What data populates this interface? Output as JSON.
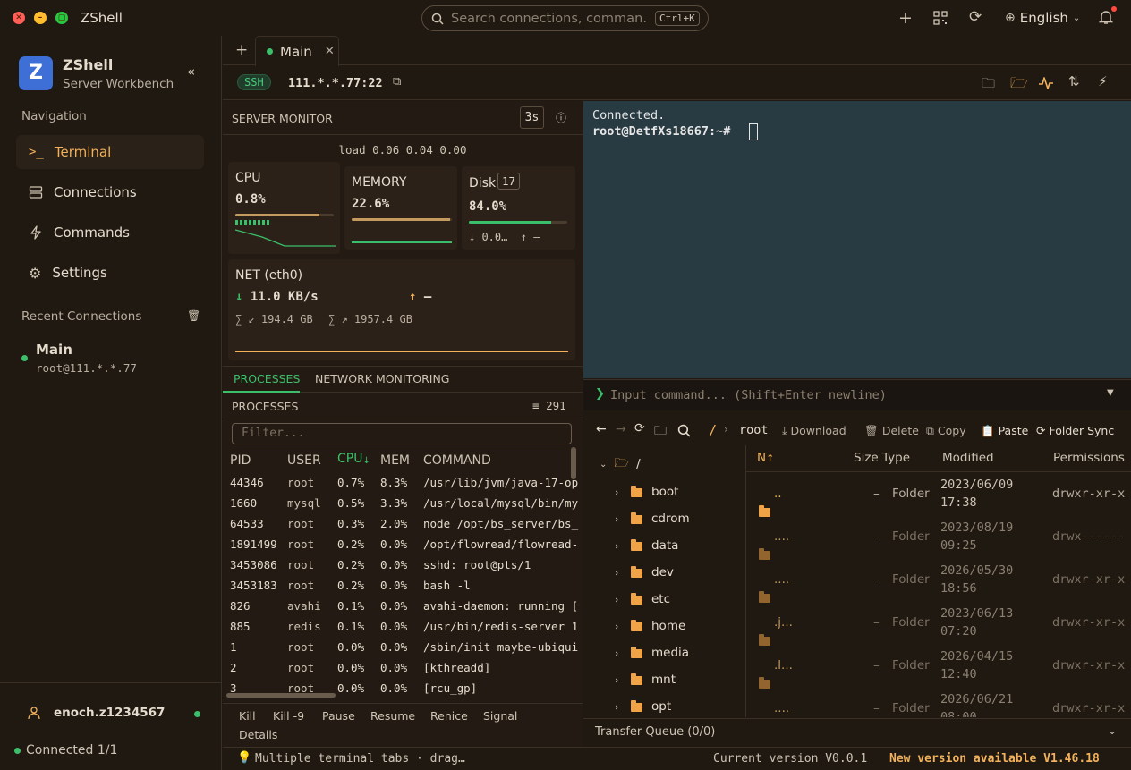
{
  "app": {
    "title": "ZShell",
    "subtitle": "Server Workbench"
  },
  "search": {
    "placeholder": "Search connections, comman…",
    "shortcut": "Ctrl+K"
  },
  "topbar": {
    "language": "English"
  },
  "sidebar": {
    "nav_heading": "Navigation",
    "items": [
      {
        "label": "Terminal"
      },
      {
        "label": "Connections"
      },
      {
        "label": "Commands"
      },
      {
        "label": "Settings"
      }
    ],
    "recent_heading": "Recent Connections",
    "recent": [
      {
        "name": "Main",
        "addr": "root@111.*.*.77"
      }
    ],
    "user": "enoch.z1234567",
    "connected": "Connected 1/1"
  },
  "tabs": [
    {
      "label": "Main"
    }
  ],
  "host": {
    "protocol": "SSH",
    "address": "111.*.*.77:22"
  },
  "monitor": {
    "title": "SERVER MONITOR",
    "interval": "3s",
    "load": "load 0.06 0.04 0.00",
    "cpu": {
      "label": "CPU",
      "value": "0.8%",
      "fraction": 0.008
    },
    "memory": {
      "label": "MEMORY",
      "value": "22.6%",
      "fraction": 0.226
    },
    "disk": {
      "label": "Disk",
      "count": "17",
      "value": "84.0%",
      "fraction": 0.84,
      "read": "0.0…",
      "write": "–"
    },
    "net": {
      "label": "NET (eth0)",
      "down": "11.0 KB/s",
      "up": "–",
      "total_down": "194.4 GB",
      "total_up": "1957.4 GB"
    }
  },
  "proc_tabs": [
    {
      "label": "PROCESSES"
    },
    {
      "label": "NETWORK MONITORING"
    }
  ],
  "processes": {
    "title": "PROCESSES",
    "count": "291",
    "filter_placeholder": "Filter...",
    "columns": [
      "PID",
      "USER",
      "CPU",
      "MEM",
      "COMMAND"
    ],
    "rows": [
      {
        "pid": "44346",
        "user": "root",
        "cpu": "0.7%",
        "mem": "8.3%",
        "cmd": "/usr/lib/jvm/java-17-op"
      },
      {
        "pid": "1660",
        "user": "mysql",
        "cpu": "0.5%",
        "mem": "3.3%",
        "cmd": "/usr/local/mysql/bin/my"
      },
      {
        "pid": "64533",
        "user": "root",
        "cpu": "0.3%",
        "mem": "2.0%",
        "cmd": "node /opt/bs_server/bs_"
      },
      {
        "pid": "1891499",
        "user": "root",
        "cpu": "0.2%",
        "mem": "0.0%",
        "cmd": "/opt/flowread/flowread-"
      },
      {
        "pid": "3453086",
        "user": "root",
        "cpu": "0.2%",
        "mem": "0.0%",
        "cmd": "sshd: root@pts/1"
      },
      {
        "pid": "3453183",
        "user": "root",
        "cpu": "0.2%",
        "mem": "0.0%",
        "cmd": "bash -l"
      },
      {
        "pid": "826",
        "user": "avahi",
        "cpu": "0.1%",
        "mem": "0.0%",
        "cmd": "avahi-daemon: running ["
      },
      {
        "pid": "885",
        "user": "redis",
        "cpu": "0.1%",
        "mem": "0.0%",
        "cmd": "/usr/bin/redis-server 1"
      },
      {
        "pid": "1",
        "user": "root",
        "cpu": "0.0%",
        "mem": "0.0%",
        "cmd": "/sbin/init maybe-ubiqui"
      },
      {
        "pid": "2",
        "user": "root",
        "cpu": "0.0%",
        "mem": "0.0%",
        "cmd": "[kthreadd]"
      },
      {
        "pid": "3",
        "user": "root",
        "cpu": "0.0%",
        "mem": "0.0%",
        "cmd": "[rcu_gp]"
      }
    ],
    "actions": [
      "Kill",
      "Kill -9",
      "Pause",
      "Resume",
      "Renice",
      "Signal",
      "Details"
    ]
  },
  "terminal": {
    "line1": "Connected.",
    "prompt": "root@DetfXs18667:~#"
  },
  "cmdline": {
    "placeholder": "Input command... (Shift+Enter newline)"
  },
  "files": {
    "breadcrumb_root": "/",
    "breadcrumb_dir": "root",
    "toolbar": [
      "Download",
      "Delete",
      "Copy",
      "Paste",
      "Folder Sync"
    ],
    "tree_root": "/",
    "tree": [
      "boot",
      "cdrom",
      "data",
      "dev",
      "etc",
      "home",
      "media",
      "mnt",
      "opt"
    ],
    "columns": [
      "N",
      "Size",
      "Type",
      "Modified",
      "Permissions"
    ],
    "rows": [
      {
        "name": "..",
        "size": "–",
        "type": "Folder",
        "date": "2023/06/09",
        "time": "17:38",
        "perm": "drwxr-xr-x"
      },
      {
        "name": "....",
        "size": "–",
        "type": "Folder",
        "date": "2023/08/19",
        "time": "09:25",
        "perm": "drwx------"
      },
      {
        "name": "....",
        "size": "–",
        "type": "Folder",
        "date": "2026/05/30",
        "time": "18:56",
        "perm": "drwxr-xr-x"
      },
      {
        "name": ".j...",
        "size": "–",
        "type": "Folder",
        "date": "2023/06/13",
        "time": "07:20",
        "perm": "drwxr-xr-x"
      },
      {
        "name": ".l...",
        "size": "–",
        "type": "Folder",
        "date": "2026/04/15",
        "time": "12:40",
        "perm": "drwxr-xr-x"
      },
      {
        "name": "....",
        "size": "–",
        "type": "Folder",
        "date": "2026/06/21",
        "time": "08:00",
        "perm": "drwxr-xr-x"
      }
    ],
    "transfer_queue": "Transfer Queue (0/0)"
  },
  "status": {
    "tip": "Multiple terminal tabs · drag…",
    "version": "Current version V0.0.1",
    "update": "New version available V1.46.18"
  },
  "colors": {
    "accent": "#f2b15a",
    "green": "#3bbf6a",
    "terminal_bg": "#283a42"
  }
}
